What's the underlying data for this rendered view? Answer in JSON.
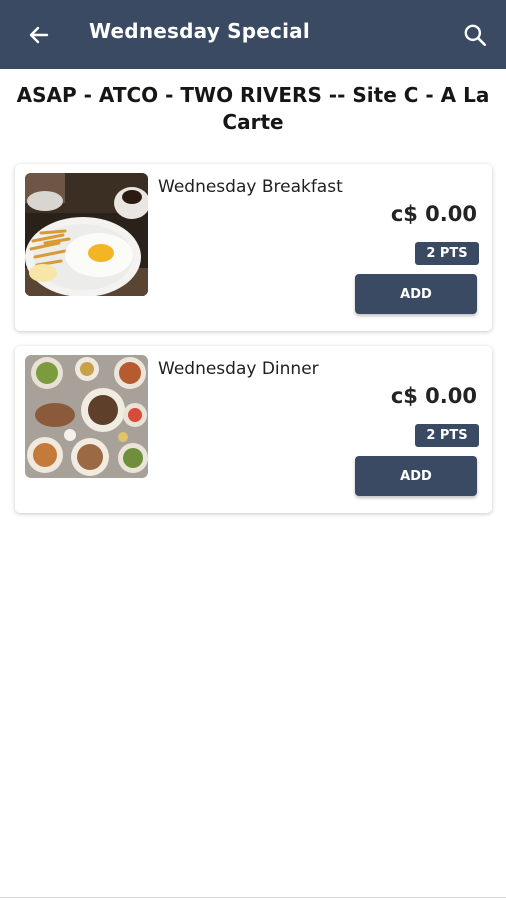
{
  "header": {
    "title": "Wednesday Special",
    "back_icon": "arrow-left-icon",
    "search_icon": "search-icon",
    "bar_color": "#3a4a63"
  },
  "page_title": "ASAP - ATCO - TWO RIVERS -- Site C - A La Carte",
  "items": [
    {
      "name": "Wednesday Breakfast",
      "price": "c$ 0.00",
      "points": "2 PTS",
      "add_label": "ADD",
      "image": "breakfast-plate-image"
    },
    {
      "name": "Wednesday Dinner",
      "price": "c$ 0.00",
      "points": "2 PTS",
      "add_label": "ADD",
      "image": "dinner-spread-image"
    }
  ]
}
